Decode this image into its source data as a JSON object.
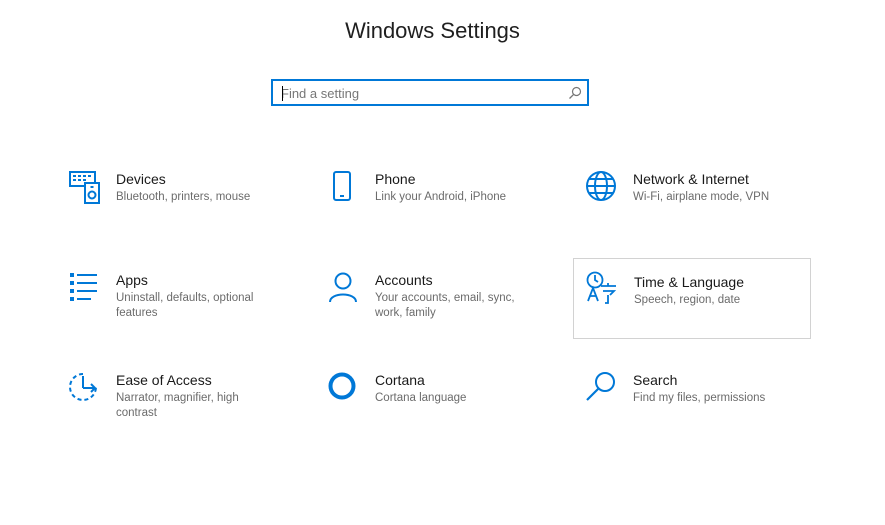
{
  "header": {
    "title": "Windows Settings"
  },
  "search": {
    "placeholder": "Find a setting",
    "icon": "search-icon"
  },
  "accent_color": "#0078d7",
  "categories": [
    {
      "label": "Devices",
      "desc": "Bluetooth, printers, mouse",
      "icon": "devices-icon"
    },
    {
      "label": "Phone",
      "desc": "Link your Android, iPhone",
      "icon": "phone-icon"
    },
    {
      "label": "Network & Internet",
      "desc": "Wi-Fi, airplane mode, VPN",
      "icon": "globe-icon"
    },
    {
      "label": "Apps",
      "desc": "Uninstall, defaults, optional features",
      "icon": "apps-list-icon"
    },
    {
      "label": "Accounts",
      "desc": "Your accounts, email, sync, work, family",
      "icon": "person-icon"
    },
    {
      "label": "Time & Language",
      "desc": "Speech, region, date",
      "icon": "time-language-icon"
    },
    {
      "label": "Ease of Access",
      "desc": "Narrator, magnifier, high contrast",
      "icon": "ease-of-access-icon"
    },
    {
      "label": "Cortana",
      "desc": "Cortana language",
      "icon": "cortana-circle-icon"
    },
    {
      "label": "Search",
      "desc": "Find my files, permissions",
      "icon": "search-magnifier-icon"
    }
  ]
}
